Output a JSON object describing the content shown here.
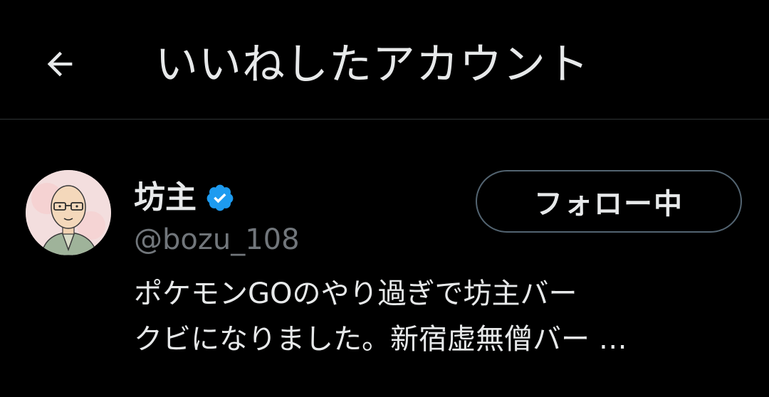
{
  "header": {
    "back_icon": "arrow-left-icon",
    "title": "いいねしたアカウント"
  },
  "user": {
    "display_name": "坊主",
    "verified_icon": "verified-badge-icon",
    "handle": "@bozu_108",
    "follow_button_label": "フォロー中",
    "bio_lines": [
      "ポケモンGOのやり過ぎで坊主バー",
      "クビになりました。新宿虚無僧バー …"
    ],
    "avatar_icon": "avatar-illustration-icon"
  },
  "colors": {
    "background": "#000000",
    "primary_text": "#e7e9ea",
    "secondary_text": "#71767b",
    "divider": "#2f3336",
    "verified": "#1d9bf0",
    "button_border": "#536471"
  }
}
